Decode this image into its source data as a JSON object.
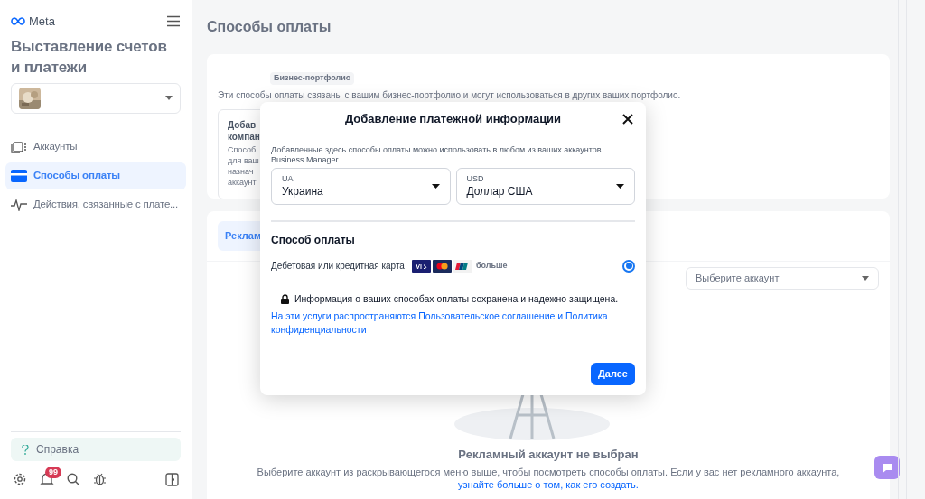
{
  "sidebar": {
    "logo": "Meta",
    "title": "Выставление счетов и платежи",
    "nav": [
      {
        "label": "Аккаунты",
        "selected": false
      },
      {
        "label": "Способы оплаты",
        "selected": true
      },
      {
        "label": "Действия, связанные с плате...",
        "selected": false
      }
    ],
    "help": "Справка",
    "notification_count": "99"
  },
  "main": {
    "heading": "Способы оплаты",
    "business_tag": "Бизнес-портфолио",
    "business_description": "Эти способы оплаты связаны с вашим бизнес-портфолио и могут использоваться в других ваших портфолио.",
    "card_fragments": [
      "Добав",
      "компан",
      "Способ",
      "для ваш",
      "назнач",
      "аккаунт"
    ],
    "tab_fragment": "Реклам",
    "account_select": {
      "placeholder": "Выберите аккаунт"
    },
    "empty_state": {
      "title": "Рекламный аккаунт не выбран",
      "text": "Выберите аккаунт из раскрывающегося меню выше, чтобы посмотреть способы оплаты. Если у вас нет рекламного аккаунта,",
      "link": "узнайте больше о том, как его создать."
    }
  },
  "dialog": {
    "title": "Добавление платежной информации",
    "intro": "Добавленные здесь способы оплаты можно использовать в любом из ваших аккаунтов Business Manager.",
    "selects": [
      {
        "label": "UA",
        "value": "Украина"
      },
      {
        "label": "USD",
        "value": "Доллар США"
      }
    ],
    "section_title": "Способ оплаты",
    "options": [
      {
        "label": "Дебетовая или кредитная карта",
        "more": "больше",
        "selected": true
      }
    ],
    "security_note": "Информация о ваших способах оплаты сохранена и надежно защищена.",
    "terms": "На эти услуги распространяются Пользовательское соглашение и Политика конфиденциальности",
    "next_button": "Далее"
  }
}
